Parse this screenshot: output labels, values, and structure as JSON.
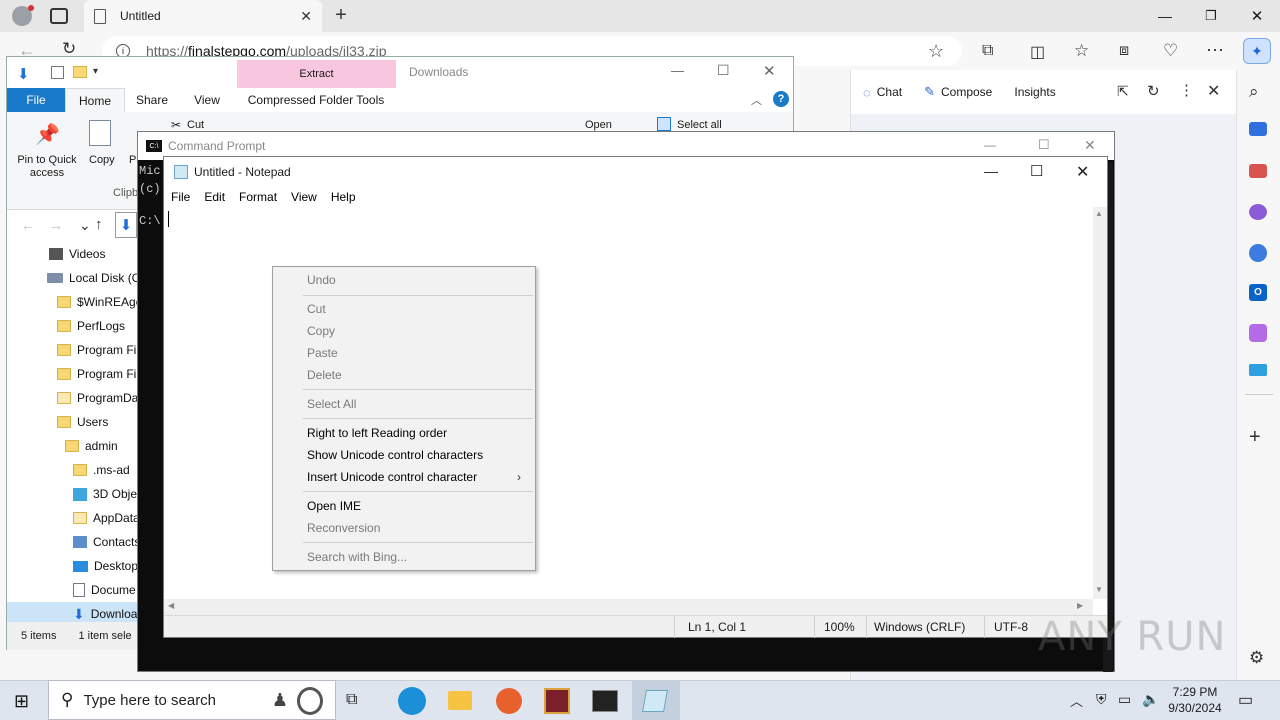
{
  "edge": {
    "tab_title": "Untitled",
    "url_prefix": "https://",
    "url_host": "finalstepgo.com",
    "url_path": "/uploads/il33.zip",
    "copilot": {
      "chat": "Chat",
      "compose": "Compose",
      "insights": "Insights"
    }
  },
  "explorer": {
    "context_tab": "Extract",
    "title_text": "Downloads",
    "ribbon_tabs": [
      "File",
      "Home",
      "Share",
      "View",
      "Compressed Folder Tools"
    ],
    "ribbon": {
      "pin_label": "Pin to Quick access",
      "copy_label": "Copy",
      "paste_label": "Pa",
      "cut_label": "Cut",
      "clip_label": "Clipb",
      "open_label": "Open",
      "select_all_label": "Select all"
    },
    "tree": [
      {
        "label": "Videos",
        "icon": "video-icon"
      },
      {
        "label": "Local Disk (C",
        "icon": "drive-icon"
      },
      {
        "label": "$WinREAge",
        "icon": "folder-icon"
      },
      {
        "label": "PerfLogs",
        "icon": "folder-icon"
      },
      {
        "label": "Program Fil",
        "icon": "folder-icon"
      },
      {
        "label": "Program Fil",
        "icon": "folder-icon"
      },
      {
        "label": "ProgramDa",
        "icon": "folder-icon"
      },
      {
        "label": "Users",
        "icon": "folder-icon"
      },
      {
        "label": "admin",
        "icon": "folder-icon"
      },
      {
        "label": ".ms-ad",
        "icon": "folder-icon"
      },
      {
        "label": "3D Objec",
        "icon": "3d-objects-icon"
      },
      {
        "label": "AppData",
        "icon": "folder-icon"
      },
      {
        "label": "Contacts",
        "icon": "contacts-icon"
      },
      {
        "label": "Desktop",
        "icon": "desktop-icon"
      },
      {
        "label": "Docume",
        "icon": "documents-icon"
      },
      {
        "label": "Downloa",
        "icon": "downloads-icon"
      }
    ],
    "status_items": "5 items",
    "status_selected": "1 item sele"
  },
  "cmd": {
    "title": "Command Prompt",
    "line1": "Mic",
    "line2": "(c)",
    "prompt": "C:\\"
  },
  "notepad": {
    "title": "Untitled - Notepad",
    "menu": [
      "File",
      "Edit",
      "Format",
      "View",
      "Help"
    ],
    "status": {
      "position": "Ln 1, Col 1",
      "zoom": "100%",
      "line_ending": "Windows (CRLF)",
      "encoding": "UTF-8"
    }
  },
  "context_menu": {
    "items": [
      {
        "label": "Undo",
        "disabled": true
      },
      {
        "label": "Cut",
        "disabled": true
      },
      {
        "label": "Copy",
        "disabled": true
      },
      {
        "label": "Paste",
        "disabled": true
      },
      {
        "label": "Delete",
        "disabled": true
      },
      {
        "label": "Select All",
        "disabled": true
      },
      {
        "label": "Right to left Reading order",
        "disabled": false
      },
      {
        "label": "Show Unicode control characters",
        "disabled": false
      },
      {
        "label": "Insert Unicode control character",
        "disabled": false,
        "submenu": true
      },
      {
        "label": "Open IME",
        "disabled": false
      },
      {
        "label": "Reconversion",
        "disabled": true
      },
      {
        "label": "Search with Bing...",
        "disabled": true
      }
    ]
  },
  "taskbar": {
    "search_placeholder": "Type here to search",
    "time": "7:29 PM",
    "date": "9/30/2024"
  },
  "watermark": "ANY RUN"
}
